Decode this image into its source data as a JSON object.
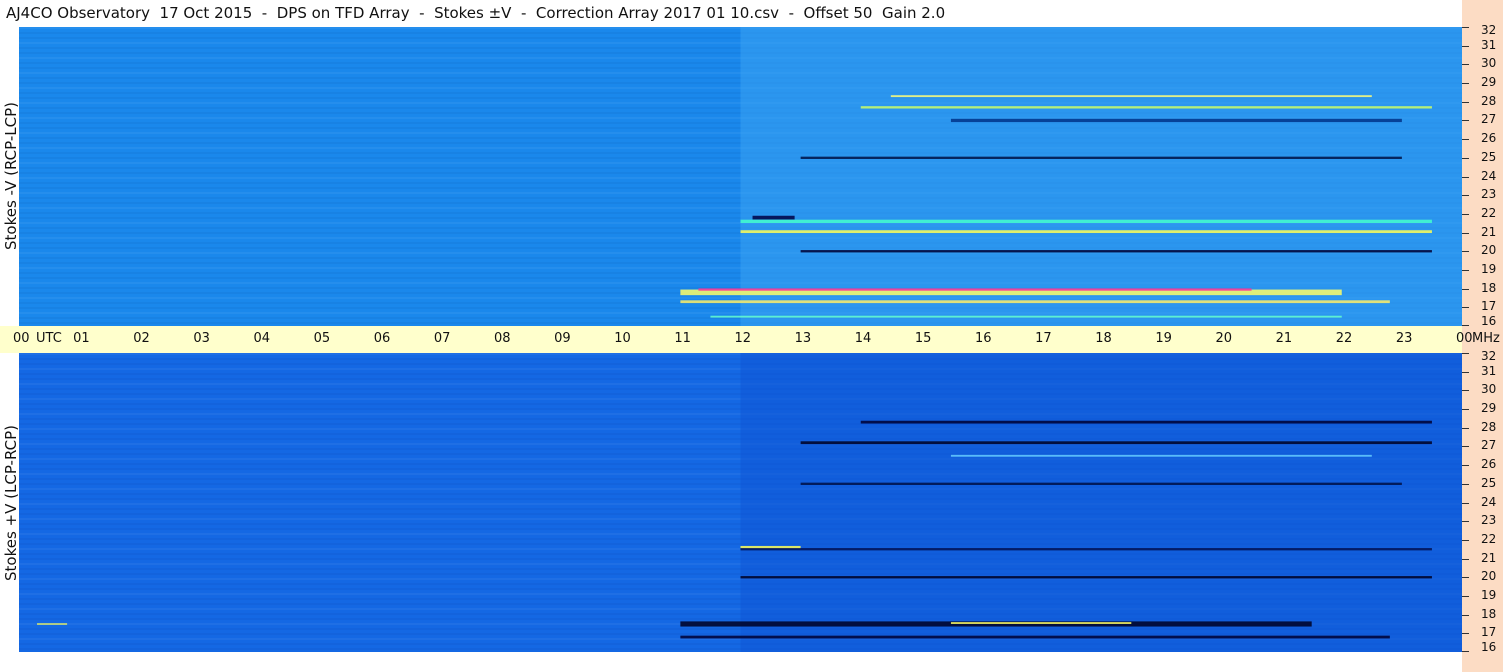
{
  "title": "AJ4CO Observatory  17 Oct 2015  -  DPS on TFD Array  -  Stokes ±V  -  Correction Array 2017 01 10.csv  -  Offset 50  Gain 2.0",
  "chart_data": [
    {
      "type": "heatmap",
      "ylabel": "Stokes -V (RCP-LCP)",
      "y_ticks": [
        "32",
        "31",
        "30",
        "29",
        "28",
        "27",
        "26",
        "25",
        "24",
        "23",
        "22",
        "21",
        "20",
        "19",
        "18",
        "17",
        "16"
      ],
      "ylim": [
        16,
        32
      ],
      "x_ticks": [
        "00",
        "01",
        "02",
        "03",
        "04",
        "05",
        "06",
        "07",
        "08",
        "09",
        "10",
        "11",
        "12",
        "13",
        "14",
        "15",
        "16",
        "17",
        "18",
        "19",
        "20",
        "21",
        "22",
        "23",
        "00"
      ],
      "xlim": [
        0,
        24
      ],
      "background_color": "#1a88ec",
      "bands": [
        {
          "t0": 11.0,
          "t1": 22.0,
          "f": 17.8,
          "color": "#ffff66",
          "w": 2.4
        },
        {
          "t0": 11.3,
          "t1": 20.5,
          "f": 17.95,
          "color": "#ff3399",
          "w": 1.0
        },
        {
          "t0": 11.0,
          "t1": 22.8,
          "f": 17.3,
          "color": "#ffee66",
          "w": 1.2
        },
        {
          "t0": 12.0,
          "t1": 23.5,
          "f": 21.6,
          "color": "#44ffcc",
          "w": 1.4
        },
        {
          "t0": 12.0,
          "t1": 23.5,
          "f": 21.05,
          "color": "#ffff55",
          "w": 1.2
        },
        {
          "t0": 12.2,
          "t1": 12.9,
          "f": 21.8,
          "color": "#000044",
          "w": 1.6
        },
        {
          "t0": 13.0,
          "t1": 23.5,
          "f": 20.0,
          "color": "#000033",
          "w": 1.0
        },
        {
          "t0": 13.0,
          "t1": 23.0,
          "f": 25.0,
          "color": "#001144",
          "w": 1.0
        },
        {
          "t0": 14.0,
          "t1": 23.5,
          "f": 27.7,
          "color": "#ccff66",
          "w": 1.0
        },
        {
          "t0": 14.5,
          "t1": 22.5,
          "f": 28.3,
          "color": "#ffff77",
          "w": 0.8
        },
        {
          "t0": 15.5,
          "t1": 23.0,
          "f": 27.0,
          "color": "#003388",
          "w": 1.4
        },
        {
          "t0": 11.5,
          "t1": 22.0,
          "f": 16.5,
          "color": "#66ffcc",
          "w": 0.8
        }
      ],
      "region": {
        "t0": 12.0,
        "t1": 24.0,
        "color": "#3aa2f2"
      }
    },
    {
      "type": "heatmap",
      "ylabel": "Stokes +V (LCP-RCP)",
      "y_ticks": [
        "32",
        "31",
        "30",
        "29",
        "28",
        "27",
        "26",
        "25",
        "24",
        "23",
        "22",
        "21",
        "20",
        "19",
        "18",
        "17",
        "16"
      ],
      "ylim": [
        16,
        32
      ],
      "x_ticks": [
        "00",
        "01",
        "02",
        "03",
        "04",
        "05",
        "06",
        "07",
        "08",
        "09",
        "10",
        "11",
        "12",
        "13",
        "14",
        "15",
        "16",
        "17",
        "18",
        "19",
        "20",
        "21",
        "22",
        "23",
        "00"
      ],
      "xlim": [
        0,
        24
      ],
      "background_color": "#1468e4",
      "bands": [
        {
          "t0": 11.0,
          "t1": 21.5,
          "f": 17.5,
          "color": "#000022",
          "w": 2.2
        },
        {
          "t0": 11.0,
          "t1": 22.8,
          "f": 16.8,
          "color": "#000033",
          "w": 1.2
        },
        {
          "t0": 15.5,
          "t1": 18.5,
          "f": 17.55,
          "color": "#ffff66",
          "w": 0.8
        },
        {
          "t0": 12.0,
          "t1": 13.0,
          "f": 21.6,
          "color": "#ffff55",
          "w": 1.2
        },
        {
          "t0": 12.0,
          "t1": 23.5,
          "f": 21.5,
          "color": "#001155",
          "w": 1.0
        },
        {
          "t0": 12.0,
          "t1": 23.5,
          "f": 20.0,
          "color": "#000022",
          "w": 1.0
        },
        {
          "t0": 13.0,
          "t1": 23.0,
          "f": 25.0,
          "color": "#001144",
          "w": 1.0
        },
        {
          "t0": 14.0,
          "t1": 23.5,
          "f": 28.3,
          "color": "#000033",
          "w": 1.2
        },
        {
          "t0": 13.0,
          "t1": 23.5,
          "f": 27.2,
          "color": "#000022",
          "w": 1.2
        },
        {
          "t0": 15.5,
          "t1": 22.5,
          "f": 26.5,
          "color": "#66ccff",
          "w": 0.8
        },
        {
          "t0": 0.3,
          "t1": 0.8,
          "f": 17.5,
          "color": "#ffff55",
          "w": 0.6
        }
      ],
      "region": {
        "t0": 12.0,
        "t1": 24.0,
        "color": "#0f56d6"
      }
    }
  ],
  "time_axis": {
    "utc_label": "UTC",
    "unit_label": "MHz"
  }
}
